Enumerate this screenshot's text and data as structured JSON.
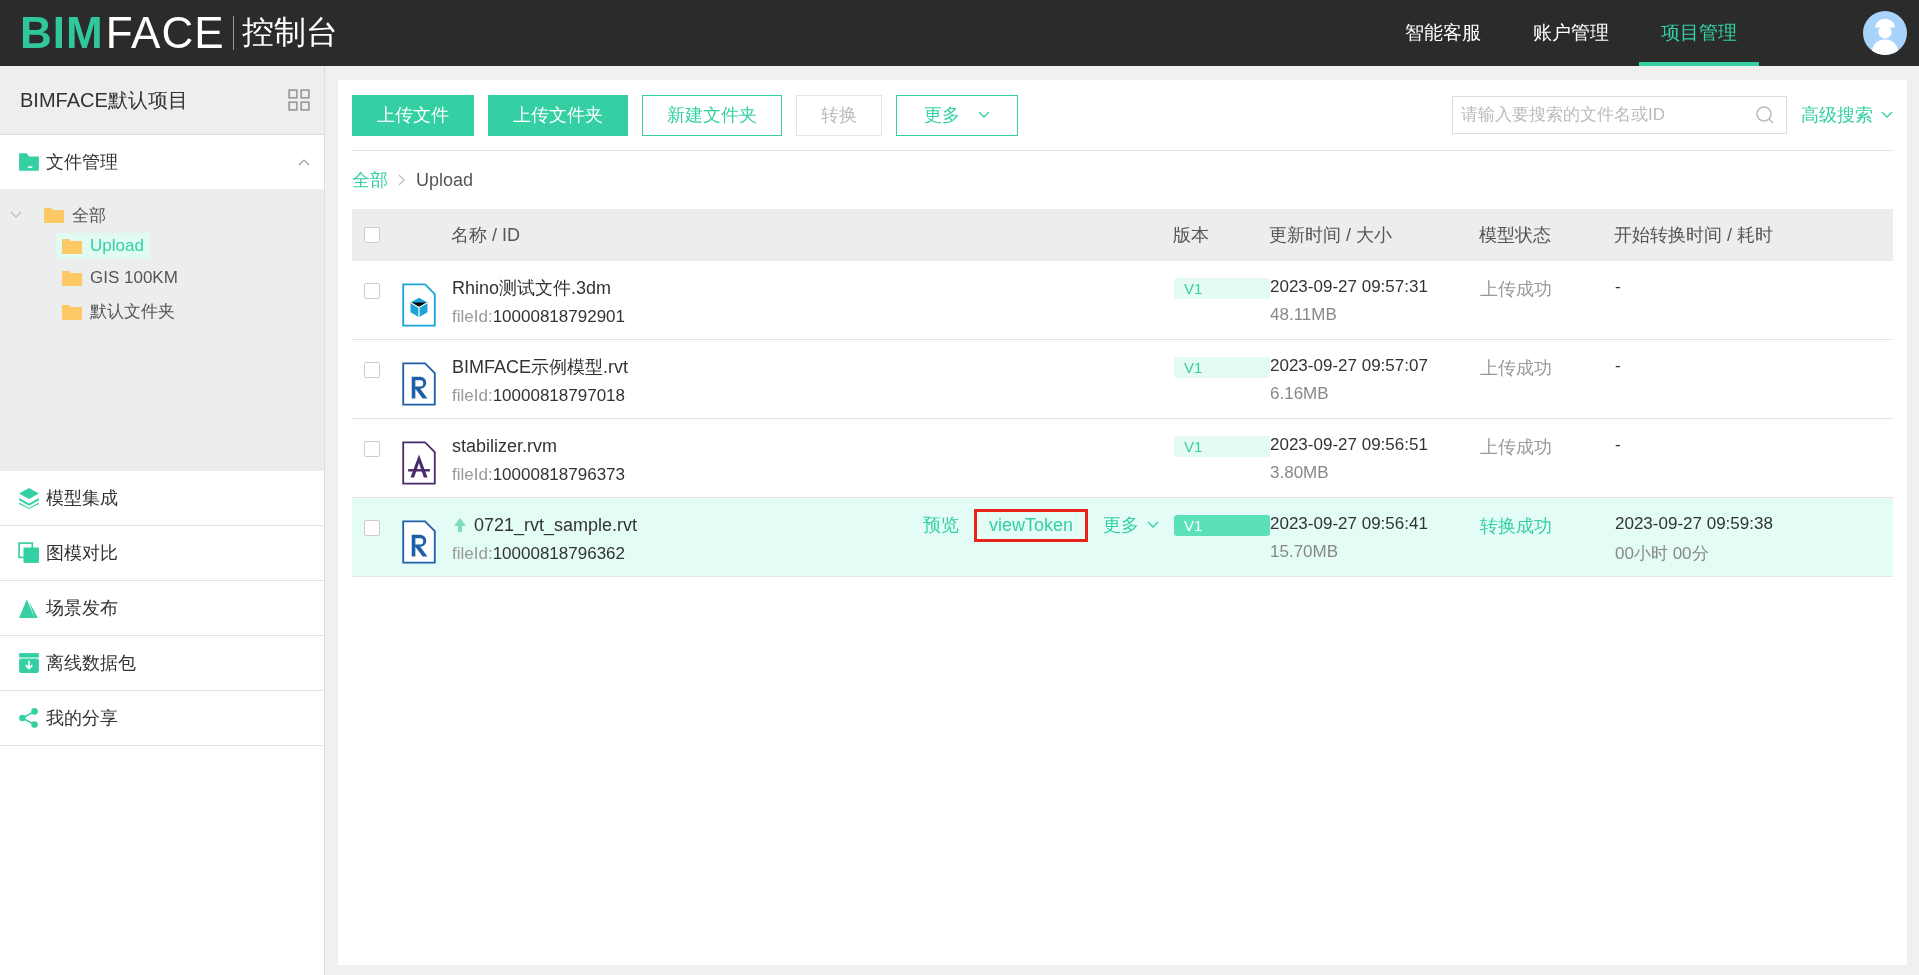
{
  "header": {
    "logo_primary": "BIM",
    "logo_secondary": "FACE",
    "title": "控制台",
    "nav": [
      {
        "label": "智能客服",
        "selected": false
      },
      {
        "label": "账户管理",
        "selected": false
      },
      {
        "label": "项目管理",
        "selected": true
      }
    ]
  },
  "sidebar": {
    "project": "BIMFACE默认项目",
    "section": {
      "label": "文件管理",
      "expanded": true
    },
    "tree": [
      {
        "label": "全部",
        "expanded": true,
        "selected": false,
        "children": [
          {
            "label": "Upload",
            "selected": true
          },
          {
            "label": "GIS 100KM",
            "selected": false
          },
          {
            "label": "默认文件夹",
            "selected": false
          }
        ]
      }
    ],
    "items": [
      {
        "label": "模型集成",
        "kind": "layers"
      },
      {
        "label": "图模对比",
        "kind": "compare"
      },
      {
        "label": "场景发布",
        "kind": "scene"
      },
      {
        "label": "离线数据包",
        "kind": "download"
      },
      {
        "label": "我的分享",
        "kind": "share"
      }
    ]
  },
  "toolbar": {
    "buttons": [
      {
        "label": "上传文件",
        "kind": "primary",
        "disabled": false
      },
      {
        "label": "上传文件夹",
        "kind": "primary",
        "disabled": false
      },
      {
        "label": "新建文件夹",
        "kind": "outline",
        "disabled": false
      },
      {
        "label": "转换",
        "kind": "outline",
        "disabled": true
      },
      {
        "label": "更多",
        "kind": "dropdown",
        "disabled": false
      }
    ],
    "search": {
      "placeholder": "请输入要搜索的文件名或ID"
    },
    "advanced": "高级搜索"
  },
  "breadcrumb": [
    "全部",
    "Upload"
  ],
  "table": {
    "select_all_checked": false,
    "columns": [
      "名称 / ID",
      "版本",
      "更新时间 / 大小",
      "模型状态",
      "开始转换时间 / 耗时"
    ],
    "rows": [
      {
        "name": "Rhino测试文件.3dm",
        "file_id_label": "fileId:",
        "file_id": "10000818792901",
        "kind": "cube",
        "linked": false,
        "highlighted": false,
        "checked": false,
        "version": "V1",
        "time": "2023-09-27 09:57:31",
        "size": "48.11MB",
        "status": "上传成功",
        "converted": false,
        "convert_time": "-"
      },
      {
        "name": "BIMFACE示例模型.rvt",
        "file_id_label": "fileId:",
        "file_id": "10000818797018",
        "kind": "revit",
        "linked": false,
        "highlighted": false,
        "checked": false,
        "version": "V1",
        "time": "2023-09-27 09:57:07",
        "size": "6.16MB",
        "status": "上传成功",
        "converted": false,
        "convert_time": "-"
      },
      {
        "name": "stabilizer.rvm",
        "file_id_label": "fileId:",
        "file_id": "10000818796373",
        "kind": "aveva",
        "linked": false,
        "highlighted": false,
        "checked": false,
        "version": "V1",
        "time": "2023-09-27 09:56:51",
        "size": "3.80MB",
        "status": "上传成功",
        "converted": false,
        "convert_time": "-"
      },
      {
        "name": "0721_rvt_sample.rvt",
        "file_id_label": "fileId:",
        "file_id": "10000818796362",
        "kind": "revit",
        "linked": true,
        "highlighted": true,
        "checked": false,
        "version": "V1",
        "time": "2023-09-27 09:56:41",
        "size": "15.70MB",
        "status": "转换成功",
        "converted": true,
        "convert_time": "2023-09-27 09:59:38",
        "duration": "00小时 00分",
        "actions": [
          {
            "label": "预览",
            "kind": "link",
            "outlined": false
          },
          {
            "label": "viewToken",
            "kind": "link",
            "outlined": true
          },
          {
            "label": "更多",
            "kind": "dropdown",
            "outlined": false
          }
        ]
      }
    ]
  }
}
